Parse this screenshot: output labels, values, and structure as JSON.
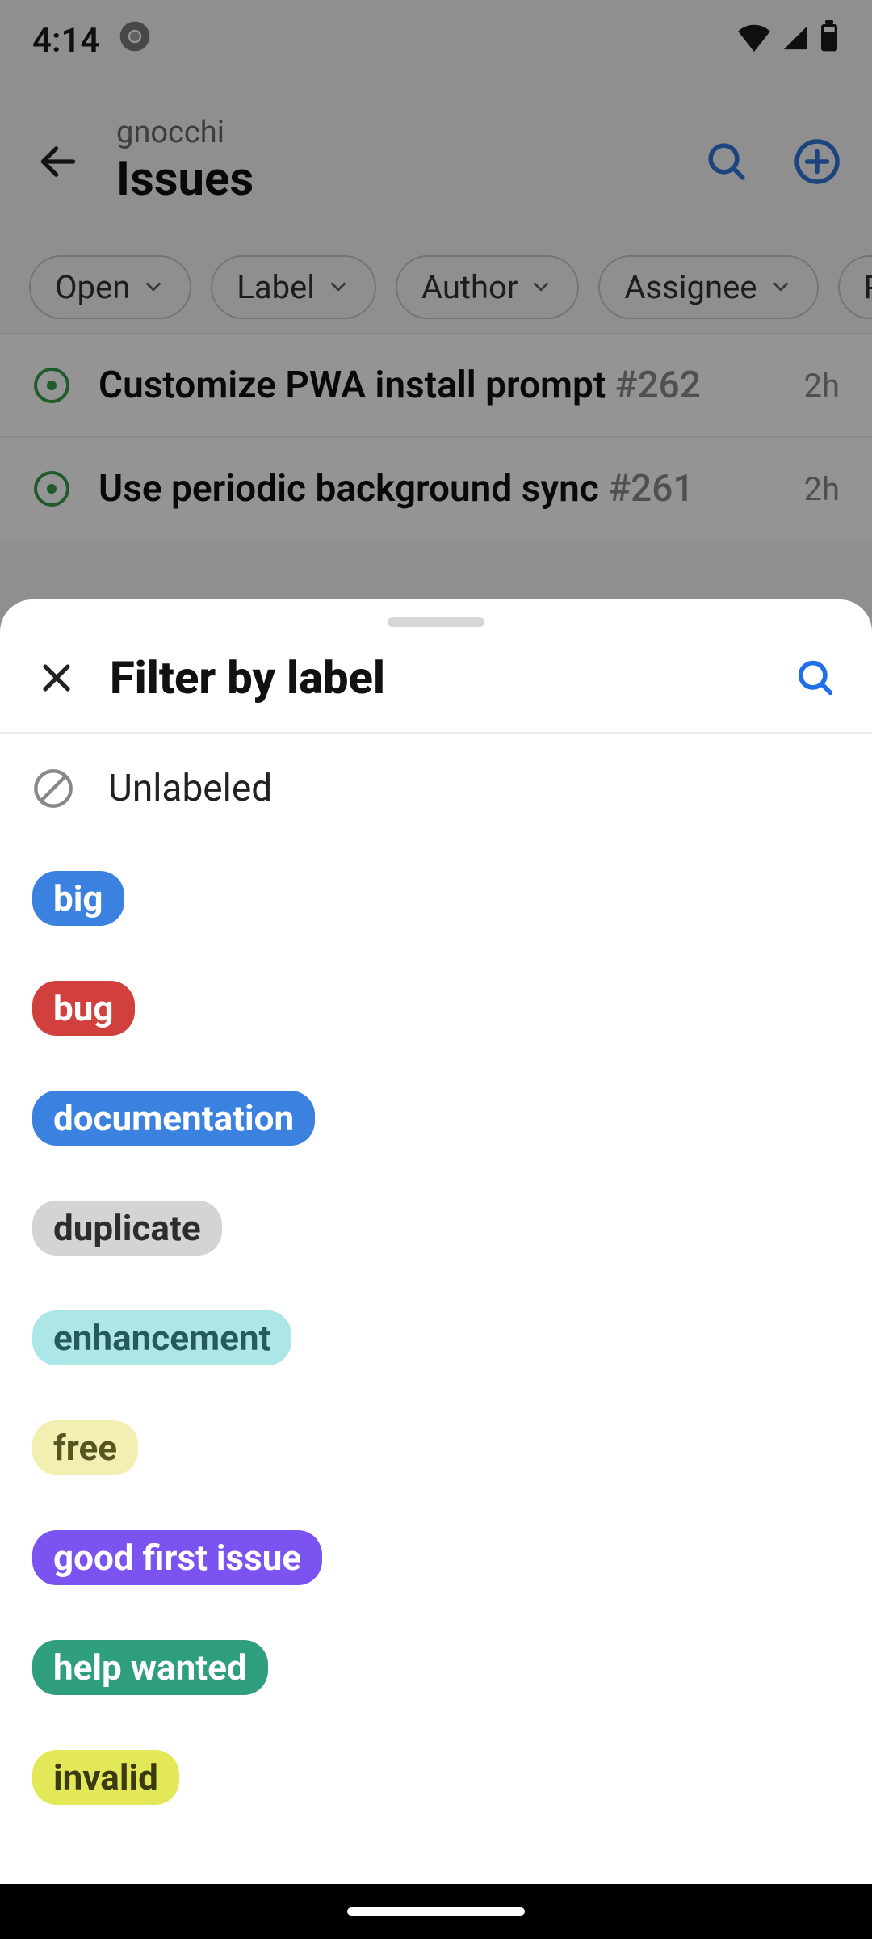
{
  "status": {
    "time": "4:14"
  },
  "header": {
    "repo": "gnocchi",
    "title": "Issues"
  },
  "chips": [
    "Open",
    "Label",
    "Author",
    "Assignee",
    "Pro"
  ],
  "issues": [
    {
      "title": "Customize PWA install prompt",
      "number": "#262",
      "time": "2h"
    },
    {
      "title": "Use periodic background sync",
      "number": "#261",
      "time": "2h"
    }
  ],
  "sheet": {
    "title": "Filter by label",
    "unlabeled": "Unlabeled",
    "labels": [
      {
        "text": "big",
        "bg": "#3b82e0",
        "fg": "#ffffff"
      },
      {
        "text": "bug",
        "bg": "#d1403d",
        "fg": "#ffffff"
      },
      {
        "text": "documentation",
        "bg": "#3b82e0",
        "fg": "#ffffff"
      },
      {
        "text": "duplicate",
        "bg": "#d2d4d6",
        "fg": "#2d2d2d"
      },
      {
        "text": "enhancement",
        "bg": "#ace6e6",
        "fg": "#265959"
      },
      {
        "text": "free",
        "bg": "#f3efb3",
        "fg": "#555522"
      },
      {
        "text": "good first issue",
        "bg": "#7b53f0",
        "fg": "#ffffff"
      },
      {
        "text": "help wanted",
        "bg": "#2e9e7f",
        "fg": "#ffffff"
      },
      {
        "text": "invalid",
        "bg": "#e3e858",
        "fg": "#3a3a12"
      }
    ]
  }
}
